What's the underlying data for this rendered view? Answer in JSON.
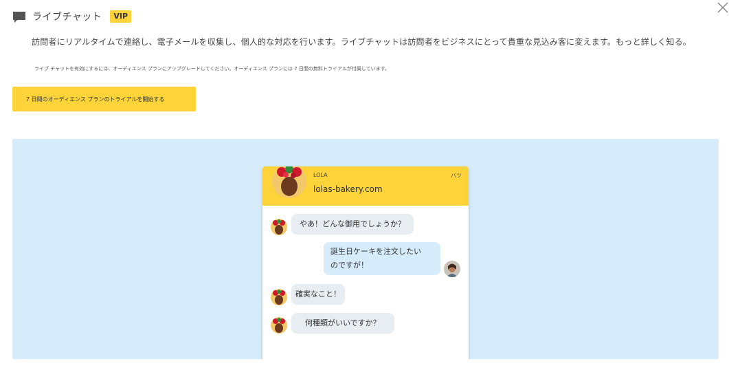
{
  "header": {
    "title": "ライブチャット",
    "badge": "VIP",
    "icons": {
      "chat": "chat-bubble-icon",
      "close": "close-icon"
    }
  },
  "description": "訪問者にリアルタイムで連絡し、電子メールを収集し、個人的な対応を行います。ライブチャットは訪問者をビジネスにとって貴重な見込み客に変えます。もっと詳しく知る。",
  "upgrade_note": "ライブ チャットを有効にするには、オーディエンス プランにアップグレードしてください。オーディエンス プランには 7 日間の無料トライアルが付属しています。",
  "cta_label": "7 日間のオーディエンス プランのトライアルを開始する",
  "preview": {
    "agent_name": "LOLA",
    "site": "lolas-bakery.com",
    "close_label": "バツ",
    "messages": [
      {
        "from": "agent",
        "text": "やあ！どんな御用でしょうか？"
      },
      {
        "from": "visitor",
        "line1": "誕生日ケーキを注文したい",
        "line2": "のですが！"
      },
      {
        "from": "agent",
        "text": "確実なこと！"
      },
      {
        "from": "agent",
        "text": "何種類がいいですか？"
      }
    ]
  },
  "colors": {
    "accent": "#fcd43a",
    "preview_bg": "#d6ecfb",
    "bubble_in": "#e8edf2",
    "bubble_out": "#d6ecfb"
  }
}
